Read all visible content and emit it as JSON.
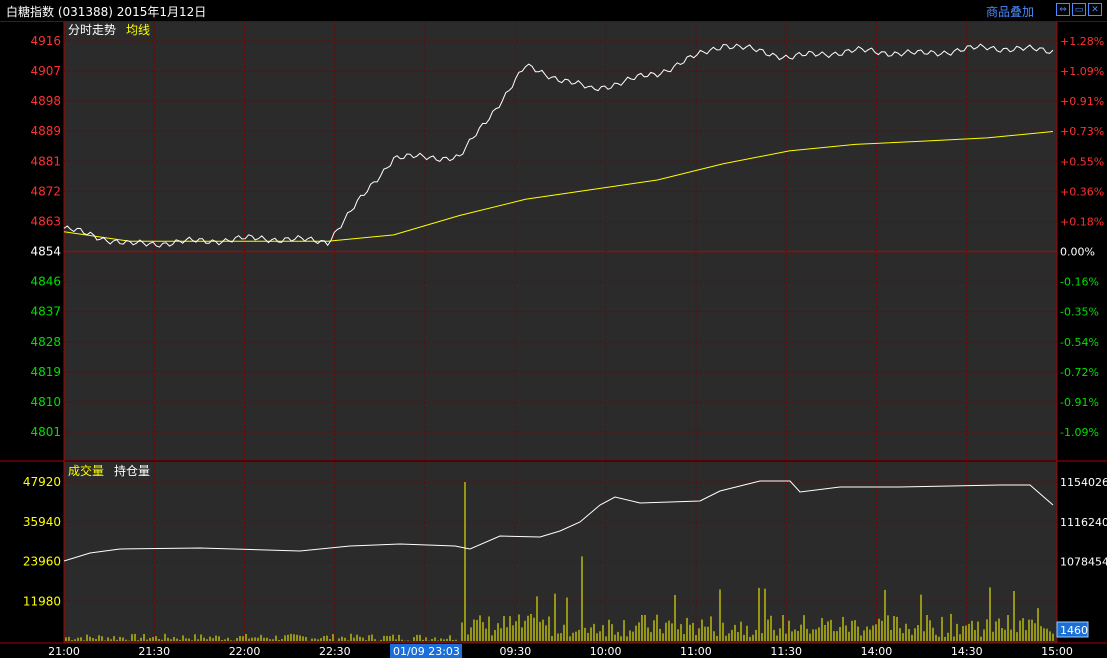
{
  "header": {
    "title": "白糖指数 (031388)  2015年1月12日",
    "overlay_label": "商品叠加",
    "window_buttons": [
      "⇔",
      "▭",
      "✕"
    ]
  },
  "price_panel": {
    "legend": {
      "minute": "分时走势",
      "avg": "均线"
    },
    "price_ticks": [
      4916,
      4907,
      4898,
      4889,
      4881,
      4872,
      4863,
      4854,
      4846,
      4837,
      4828,
      4819,
      4810,
      4801
    ],
    "pct_ticks": [
      "+1.28%",
      "+1.09%",
      "+0.91%",
      "+0.73%",
      "+0.55%",
      "+0.36%",
      "+0.18%",
      "0.00%",
      "-0.16%",
      "-0.35%",
      "-0.54%",
      "-0.72%",
      "-0.91%",
      "-1.09%"
    ],
    "colors": {
      "up": "#ff3030",
      "down": "#00e000",
      "flat": "#ffffff",
      "price_line": "#ffffff",
      "avg_line": "#ffff00",
      "grid": "#800000"
    }
  },
  "volume_panel": {
    "legend": {
      "volume": "成交量",
      "oi": "持仓量"
    },
    "volume_ticks": [
      47920,
      35940,
      23960,
      11980
    ],
    "oi_ticks": [
      1154026,
      1116240,
      1078454
    ],
    "last_volume": "1460",
    "colors": {
      "bar": "#ffff00",
      "oi_line": "#ffffff",
      "axis_text": "#ffff00"
    }
  },
  "time_axis": {
    "labels": [
      "21:00",
      "21:30",
      "22:00",
      "22:30",
      "23:0",
      "09:30",
      "10:00",
      "11:00",
      "11:30",
      "14:00",
      "14:30",
      "15:00"
    ],
    "cursor_label": "01/09 23:03"
  },
  "chart_data": {
    "type": "line",
    "x": [
      "21:00",
      "21:30",
      "22:00",
      "22:30",
      "23:00",
      "09:00",
      "09:30",
      "10:00",
      "10:15",
      "10:30",
      "11:00",
      "11:30",
      "13:30",
      "14:00",
      "14:30",
      "15:00"
    ],
    "series": [
      {
        "name": "分时走势",
        "values": [
          4858,
          4853,
          4854,
          4855,
          4854,
          4880,
          4880,
          4908,
          4901,
          4906,
          4915,
          4911,
          4913,
          4912,
          4914,
          4913
        ]
      },
      {
        "name": "均线",
        "values": [
          4857,
          4854,
          4854,
          4854,
          4854,
          4856,
          4862,
          4867,
          4870,
          4873,
          4878,
          4882,
          4884,
          4885,
          4886,
          4888
        ]
      }
    ],
    "ylim": [
      4795,
      4916
    ],
    "grid": true
  }
}
